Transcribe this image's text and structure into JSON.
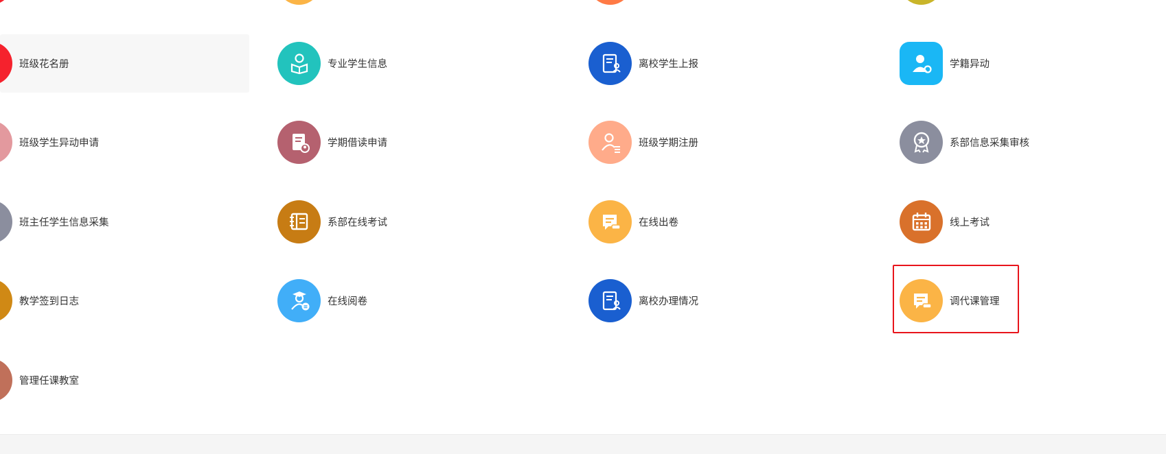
{
  "colors": {
    "red": "#f5222d",
    "teal": "#22c3bd",
    "blue": "#1a5fd0",
    "sky": "#1ab7f5",
    "pink": "#e3999e",
    "rose": "#b5616f",
    "salmon": "#ffab8a",
    "gray": "#8b8e9e",
    "amber": "#c77c14",
    "yellow": "#fbb446",
    "orange": "#d9712b",
    "lightblue": "#41aef8",
    "brown": "#c0705a",
    "highlight": "#e8141b"
  },
  "grid": {
    "rows": [
      [
        {
          "label": "班级花名册",
          "icon": "roster-icon",
          "color": "#f5222d"
        },
        {
          "label": "专业学生信息",
          "icon": "student-reading-icon",
          "color": "#22c3bd"
        },
        {
          "label": "离校学生上报",
          "icon": "clipboard-person-icon",
          "color": "#1a5fd0"
        },
        {
          "label": "学籍异动",
          "icon": "user-gear-icon",
          "color": "#1ab7f5"
        }
      ],
      [
        {
          "label": "班级学生异动申请",
          "icon": "student-change-icon",
          "color": "#e3999e"
        },
        {
          "label": "学期借读申请",
          "icon": "document-person-icon",
          "color": "#b5616f"
        },
        {
          "label": "班级学期注册",
          "icon": "user-list-icon",
          "color": "#ffab8a"
        },
        {
          "label": "系部信息采集审核",
          "icon": "award-badge-icon",
          "color": "#8b8e9e"
        }
      ],
      [
        {
          "label": "班主任学生信息采集",
          "icon": "teacher-collect-icon",
          "color": "#8b8e9e"
        },
        {
          "label": "系部在线考试",
          "icon": "exam-book-icon",
          "color": "#c77c14"
        },
        {
          "label": "在线出卷",
          "icon": "message-paper-icon",
          "color": "#fbb446"
        },
        {
          "label": "线上考试",
          "icon": "calendar-icon",
          "color": "#d9712b"
        }
      ],
      [
        {
          "label": "教学签到日志",
          "icon": "signin-log-icon",
          "color": "#d08915"
        },
        {
          "label": "在线阅卷",
          "icon": "graduate-person-icon",
          "color": "#41aef8"
        },
        {
          "label": "离校办理情况",
          "icon": "clipboard-person-icon",
          "color": "#1a5fd0"
        },
        {
          "label": "调代课管理",
          "icon": "message-paper-icon",
          "color": "#fbb446"
        }
      ],
      [
        {
          "label": "管理任课教室",
          "icon": "classroom-icon",
          "color": "#c0705a"
        }
      ]
    ],
    "top_partial_colors": [
      "#f5222d",
      "#fbb446",
      "#ff7a45",
      "#c9b52a"
    ]
  }
}
